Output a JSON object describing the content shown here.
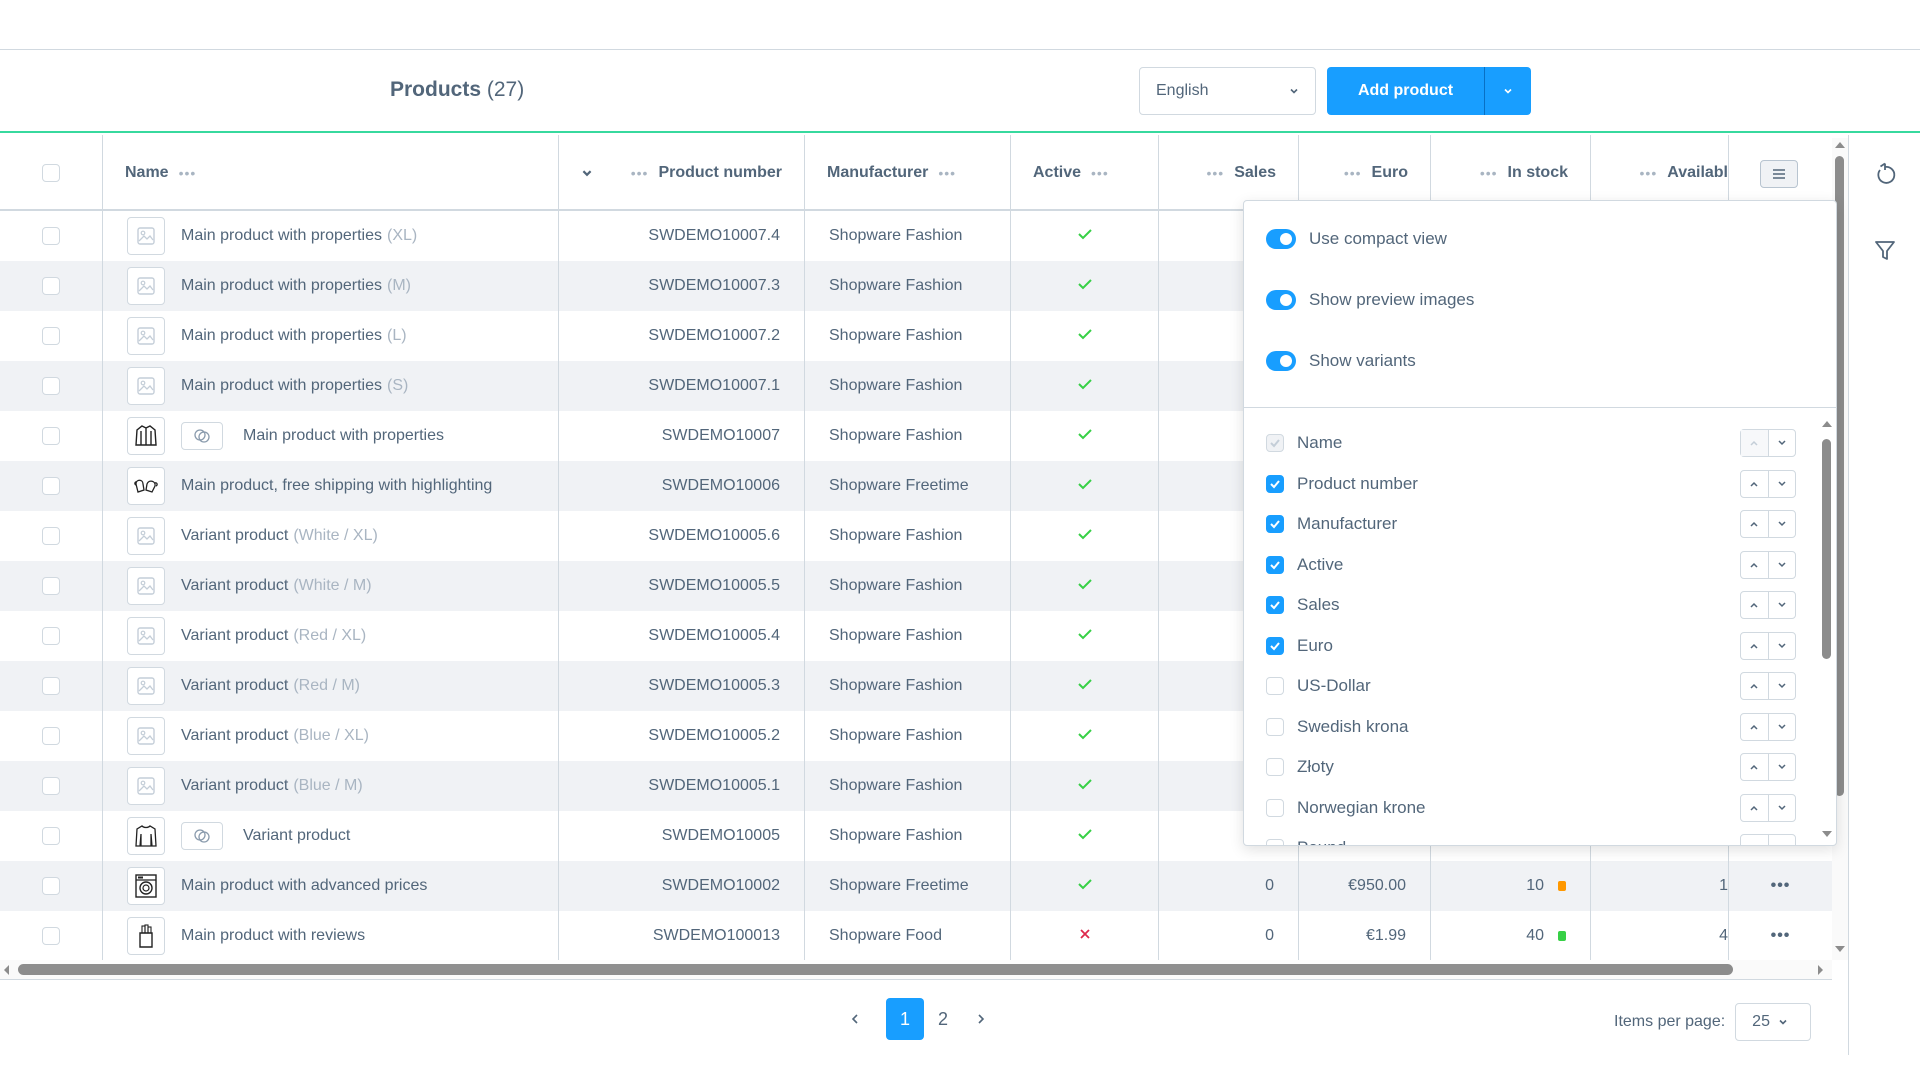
{
  "header": {
    "title": "Products",
    "count": "(27)",
    "language": "English",
    "add_product_label": "Add product"
  },
  "colors": {
    "accent": "#189eff",
    "success": "#37d046",
    "danger": "#de294c",
    "warning": "#ff9800",
    "header_border": "#37d99e"
  },
  "columns": {
    "name": "Name",
    "product_number": "Product number",
    "manufacturer": "Manufacturer",
    "active": "Active",
    "sales": "Sales",
    "euro": "Euro",
    "in_stock": "In stock",
    "available": "Availabl"
  },
  "rows": [
    {
      "name": "Main product with properties",
      "suffix": "(XL)",
      "thumb": "placeholder-image",
      "variant_badge": false,
      "number": "SWDEMO10007.4",
      "manufacturer": "Shopware Fashion",
      "active": true
    },
    {
      "name": "Main product with properties",
      "suffix": "(M)",
      "thumb": "placeholder-image",
      "variant_badge": false,
      "number": "SWDEMO10007.3",
      "manufacturer": "Shopware Fashion",
      "active": true
    },
    {
      "name": "Main product with properties",
      "suffix": "(L)",
      "thumb": "placeholder-image",
      "variant_badge": false,
      "number": "SWDEMO10007.2",
      "manufacturer": "Shopware Fashion",
      "active": true
    },
    {
      "name": "Main product with properties",
      "suffix": "(S)",
      "thumb": "placeholder-image",
      "variant_badge": false,
      "number": "SWDEMO10007.1",
      "manufacturer": "Shopware Fashion",
      "active": true
    },
    {
      "name": "Main product with properties",
      "suffix": "",
      "thumb": "jacket",
      "variant_badge": true,
      "number": "SWDEMO10007",
      "manufacturer": "Shopware Fashion",
      "active": true
    },
    {
      "name": "Main product, free shipping with highlighting",
      "suffix": "",
      "thumb": "mittens",
      "variant_badge": false,
      "number": "SWDEMO10006",
      "manufacturer": "Shopware Freetime",
      "active": true
    },
    {
      "name": "Variant product",
      "suffix": "(White / XL)",
      "thumb": "placeholder-image",
      "variant_badge": false,
      "number": "SWDEMO10005.6",
      "manufacturer": "Shopware Fashion",
      "active": true
    },
    {
      "name": "Variant product",
      "suffix": "(White / M)",
      "thumb": "placeholder-image",
      "variant_badge": false,
      "number": "SWDEMO10005.5",
      "manufacturer": "Shopware Fashion",
      "active": true
    },
    {
      "name": "Variant product",
      "suffix": "(Red / XL)",
      "thumb": "placeholder-image",
      "variant_badge": false,
      "number": "SWDEMO10005.4",
      "manufacturer": "Shopware Fashion",
      "active": true
    },
    {
      "name": "Variant product",
      "suffix": "(Red / M)",
      "thumb": "placeholder-image",
      "variant_badge": false,
      "number": "SWDEMO10005.3",
      "manufacturer": "Shopware Fashion",
      "active": true
    },
    {
      "name": "Variant product",
      "suffix": "(Blue / XL)",
      "thumb": "placeholder-image",
      "variant_badge": false,
      "number": "SWDEMO10005.2",
      "manufacturer": "Shopware Fashion",
      "active": true
    },
    {
      "name": "Variant product",
      "suffix": "(Blue / M)",
      "thumb": "placeholder-image",
      "variant_badge": false,
      "number": "SWDEMO10005.1",
      "manufacturer": "Shopware Fashion",
      "active": true
    },
    {
      "name": "Variant product",
      "suffix": "",
      "thumb": "sweater",
      "variant_badge": true,
      "number": "SWDEMO10005",
      "manufacturer": "Shopware Fashion",
      "active": true
    },
    {
      "name": "Main product with advanced prices",
      "suffix": "",
      "thumb": "washing-machine",
      "variant_badge": false,
      "number": "SWDEMO10002",
      "manufacturer": "Shopware Freetime",
      "active": true,
      "sales": "0",
      "euro": "€950.00",
      "stock": "10",
      "stock_status": "warning",
      "available": "1"
    },
    {
      "name": "Main product with reviews",
      "suffix": "",
      "thumb": "food-pack",
      "variant_badge": false,
      "number": "SWDEMO100013",
      "manufacturer": "Shopware Food",
      "active": false,
      "sales": "0",
      "euro": "€1.99",
      "stock": "40",
      "stock_status": "success",
      "available": "4"
    }
  ],
  "settings": {
    "toggles": [
      {
        "label": "Use compact view",
        "on": true
      },
      {
        "label": "Show preview images",
        "on": true
      },
      {
        "label": "Show variants",
        "on": true
      }
    ],
    "columns": [
      {
        "label": "Name",
        "checked": true,
        "disabled": true
      },
      {
        "label": "Product number",
        "checked": true,
        "disabled": false
      },
      {
        "label": "Manufacturer",
        "checked": true,
        "disabled": false
      },
      {
        "label": "Active",
        "checked": true,
        "disabled": false
      },
      {
        "label": "Sales",
        "checked": true,
        "disabled": false
      },
      {
        "label": "Euro",
        "checked": true,
        "disabled": false
      },
      {
        "label": "US-Dollar",
        "checked": false,
        "disabled": false
      },
      {
        "label": "Swedish krona",
        "checked": false,
        "disabled": false
      },
      {
        "label": "Złoty",
        "checked": false,
        "disabled": false
      },
      {
        "label": "Norwegian krone",
        "checked": false,
        "disabled": false
      },
      {
        "label": "Pound",
        "checked": false,
        "disabled": false
      }
    ]
  },
  "pagination": {
    "pages": [
      "1",
      "2"
    ],
    "current": "1",
    "items_per_page_label": "Items per page:",
    "items_per_page": "25"
  }
}
